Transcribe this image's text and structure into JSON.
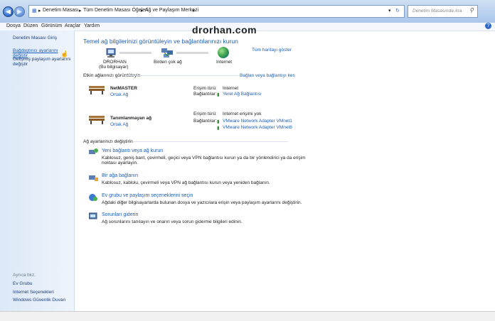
{
  "address": {
    "crumbs": [
      "Denetim Masası",
      "Tüm Denetim Masası Öğeleri",
      "Ağ ve Paylaşım Merkezi"
    ],
    "search_placeholder": "Denetim Masasında Ara"
  },
  "menu": [
    "Dosya",
    "Düzen",
    "Görünüm",
    "Araçlar",
    "Yardım"
  ],
  "watermark": "drorhan.com",
  "sidebar": {
    "items": [
      "Denetim Masası Giriş",
      "Bağdaştırıcı ayarlarını değiştir",
      "Gelişmiş paylaşım ayarlarını",
      "değiştir"
    ],
    "see_also_title": "Ayrıca bkz.",
    "see_also": [
      "Ev Grubu",
      "Internet Seçenekleri",
      "Windows Güvenlik Duvarı"
    ]
  },
  "main": {
    "heading": "Temel ağ bilgilerinizi görüntüleyin ve bağlantılarınızı kurun",
    "full_map_link": "Tüm haritayı göster",
    "map": {
      "computer_name": "DRORHAN",
      "computer_sub": "(Bu bilgisayar)",
      "middle": "Birden çok ağ",
      "internet": "Internet"
    },
    "active_title": "Etkin ağlarınızı görüntüleyin",
    "connect_link": "Bağlan veya bağlantıyı kes",
    "networks": [
      {
        "name": "NetMASTER",
        "type": "Ortak Ağ",
        "access_label": "Erişim türü:",
        "access_value": "Internet",
        "conn_label": "Bağlantılar:",
        "connections": [
          "Yerel Ağ Bağlantısı"
        ]
      },
      {
        "name": "Tanımlanmayan ağ",
        "type": "Ortak Ağ",
        "access_label": "Erişim türü:",
        "access_value": "Internet erişimi yok",
        "conn_label": "Bağlantılar:",
        "connections": [
          "VMware Network Adapter VMnet1",
          "VMware Network Adapter VMnet8"
        ]
      }
    ],
    "change_title": "Ağ ayarlarınızı değiştirin",
    "tasks": [
      {
        "title": "Yeni bağlantı veya ağ kurun",
        "desc1": "Kablosuz, geniş bant, çevirmeli, geçici veya VPN bağlantısı kurun ya da bir yönlendirici ya da erişim",
        "desc2": "noktası ayarlayın."
      },
      {
        "title": "Bir ağa bağlanın",
        "desc1": "Kablosuz, kablolu, çevirmeli veya VPN ağ bağlantısı kurun veya yeniden bağlanın.",
        "desc2": ""
      },
      {
        "title": "Ev grubu ve paylaşım seçeneklerini seçin",
        "desc1": "Ağdaki diğer bilgisayarlarda bulunan dosya ve yazıcılara erişin veya paylaşım ayarlarını değiştirin.",
        "desc2": ""
      },
      {
        "title": "Sorunları giderin",
        "desc1": "Ağ sorunlarını tanılayın ve onarın veya sorun giderme bilgileri edinin.",
        "desc2": ""
      }
    ]
  },
  "colors": {
    "link": "#1e5eb6",
    "heading": "#1e5eb6",
    "sidebar": "#dce8f7"
  }
}
